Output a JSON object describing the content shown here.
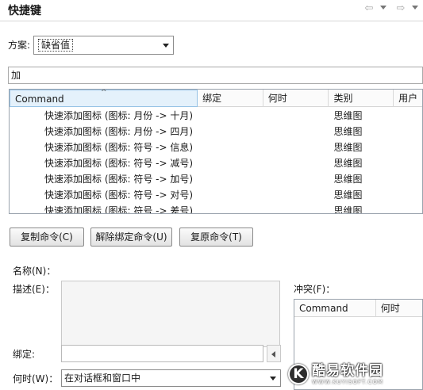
{
  "header": {
    "title": "快捷键",
    "nav_back_glyph": "⇦",
    "nav_forward_glyph": "⇨"
  },
  "scheme": {
    "label": "方案:",
    "selected": "缺省值"
  },
  "filter": {
    "value": "加"
  },
  "table": {
    "columns": [
      "Command",
      "绑定",
      "何时",
      "类别",
      "用户"
    ],
    "sorted_column": "Command",
    "rows": [
      {
        "command": "快速添加图标 (图标: 月份 -> 十月)",
        "binding": "",
        "when": "",
        "category": "思维图",
        "user": ""
      },
      {
        "command": "快速添加图标 (图标: 月份 -> 四月)",
        "binding": "",
        "when": "",
        "category": "思维图",
        "user": ""
      },
      {
        "command": "快速添加图标 (图标: 符号 -> 信息)",
        "binding": "",
        "when": "",
        "category": "思维图",
        "user": ""
      },
      {
        "command": "快速添加图标 (图标: 符号 -> 减号)",
        "binding": "",
        "when": "",
        "category": "思维图",
        "user": ""
      },
      {
        "command": "快速添加图标 (图标: 符号 -> 加号)",
        "binding": "",
        "when": "",
        "category": "思维图",
        "user": ""
      },
      {
        "command": "快速添加图标 (图标: 符号 -> 对号)",
        "binding": "",
        "when": "",
        "category": "思维图",
        "user": ""
      },
      {
        "command": "快速添加图标 (图标: 符号 -> 差号)",
        "binding": "",
        "when": "",
        "category": "思维图",
        "user": ""
      }
    ]
  },
  "buttons": {
    "copy": "复制命令(C)",
    "unbind": "解除绑定命令(U)",
    "restore": "复原命令(T)"
  },
  "details": {
    "name_label": "名称(N)：",
    "desc_label": "描述(E)：",
    "conflict_label": "冲突(F)：",
    "binding_label": "绑定:",
    "when_label": "何时(W)：",
    "when_value": "在对话框和窗口中"
  },
  "conflict_table": {
    "columns": [
      "Command",
      "何时"
    ]
  },
  "watermark": {
    "badge": "K",
    "text_cn": "酷易软件园",
    "text_en": "WWW.KUYISOFT.COM"
  }
}
